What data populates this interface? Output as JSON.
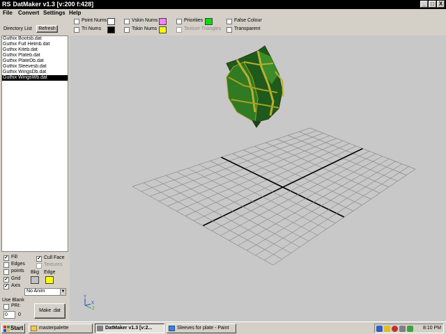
{
  "window": {
    "logo": "RS",
    "title": "DatMaker v1.3  [v:200 f:428]",
    "minimize": "_",
    "maximize": "□",
    "close": "X"
  },
  "menu": [
    "File",
    "Convert",
    "Settings",
    "Help"
  ],
  "toolbar": {
    "directory_label": "Directory List",
    "refresh_label": "Refresh",
    "point_nums": "Point Nums",
    "tri_nums": "Tri Nums",
    "vskin_nums": "Vskin Nums",
    "tskin_nums": "Tskin Nums",
    "priorities": "Priorities",
    "texture_triangles": "Texture Triangles",
    "false_colour": "False Colour",
    "transparent": "Transparent",
    "colors": {
      "point_nums": "#ffffff",
      "tri_nums": "#000000",
      "vskin_nums": "#ff80ff",
      "tskin_nums": "#ffff00",
      "priorities": "#00e000"
    }
  },
  "files": [
    "Guthix Bootsb.dat",
    "Guthix Full Helmb.dat",
    "Guthix Kiteb.dat",
    "Guthix Plateb.dat",
    "Guthix PlateDb.dat",
    "Guthix Sleevesb.dat",
    "Guthix WingsDb.dat",
    "Guthix WingsWb.dat"
  ],
  "selected_file": "Guthix WingsWb.dat",
  "options": {
    "fill": "Fill",
    "edges": "Edges",
    "points": "points",
    "grid": "Grid",
    "axis": "Axis",
    "cull_face": "Cull Face",
    "textures": "Textures",
    "bkg": "Bkg",
    "edge": "Edge",
    "bkg_color": "#c0c0c0",
    "edge_color": "#ffff00",
    "anim_value": "No Anim",
    "use_blank": "Use Blank",
    "pri": "PRI:",
    "pri_value": "0",
    "pri_num": "0",
    "make_dat": "Make .dat"
  },
  "axes": {
    "y": "Y",
    "x": "X",
    "z": "Z"
  },
  "taskbar": {
    "start": "Start",
    "tasks": [
      "masterpalette",
      "DatMaker v1.3  [v:2...",
      "Sleeves for plate - Paint"
    ],
    "clock": "8:10 PM"
  }
}
